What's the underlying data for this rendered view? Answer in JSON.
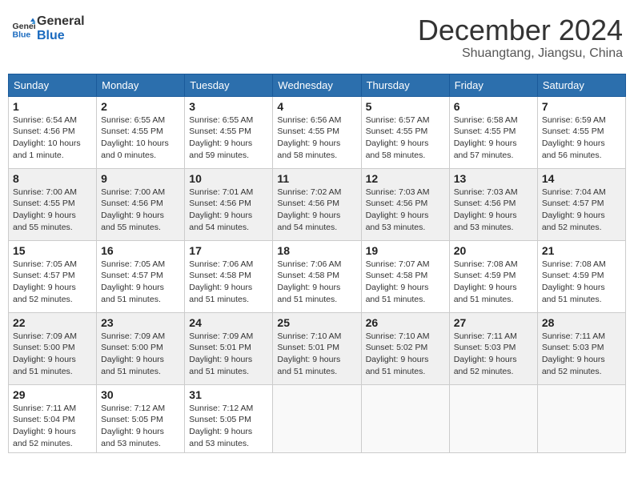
{
  "header": {
    "logo_general": "General",
    "logo_blue": "Blue",
    "month_title": "December 2024",
    "subtitle": "Shuangtang, Jiangsu, China"
  },
  "days_of_week": [
    "Sunday",
    "Monday",
    "Tuesday",
    "Wednesday",
    "Thursday",
    "Friday",
    "Saturday"
  ],
  "weeks": [
    [
      {
        "day": "1",
        "info": "Sunrise: 6:54 AM\nSunset: 4:56 PM\nDaylight: 10 hours\nand 1 minute."
      },
      {
        "day": "2",
        "info": "Sunrise: 6:55 AM\nSunset: 4:55 PM\nDaylight: 10 hours\nand 0 minutes."
      },
      {
        "day": "3",
        "info": "Sunrise: 6:55 AM\nSunset: 4:55 PM\nDaylight: 9 hours\nand 59 minutes."
      },
      {
        "day": "4",
        "info": "Sunrise: 6:56 AM\nSunset: 4:55 PM\nDaylight: 9 hours\nand 58 minutes."
      },
      {
        "day": "5",
        "info": "Sunrise: 6:57 AM\nSunset: 4:55 PM\nDaylight: 9 hours\nand 58 minutes."
      },
      {
        "day": "6",
        "info": "Sunrise: 6:58 AM\nSunset: 4:55 PM\nDaylight: 9 hours\nand 57 minutes."
      },
      {
        "day": "7",
        "info": "Sunrise: 6:59 AM\nSunset: 4:55 PM\nDaylight: 9 hours\nand 56 minutes."
      }
    ],
    [
      {
        "day": "8",
        "info": "Sunrise: 7:00 AM\nSunset: 4:55 PM\nDaylight: 9 hours\nand 55 minutes."
      },
      {
        "day": "9",
        "info": "Sunrise: 7:00 AM\nSunset: 4:56 PM\nDaylight: 9 hours\nand 55 minutes."
      },
      {
        "day": "10",
        "info": "Sunrise: 7:01 AM\nSunset: 4:56 PM\nDaylight: 9 hours\nand 54 minutes."
      },
      {
        "day": "11",
        "info": "Sunrise: 7:02 AM\nSunset: 4:56 PM\nDaylight: 9 hours\nand 54 minutes."
      },
      {
        "day": "12",
        "info": "Sunrise: 7:03 AM\nSunset: 4:56 PM\nDaylight: 9 hours\nand 53 minutes."
      },
      {
        "day": "13",
        "info": "Sunrise: 7:03 AM\nSunset: 4:56 PM\nDaylight: 9 hours\nand 53 minutes."
      },
      {
        "day": "14",
        "info": "Sunrise: 7:04 AM\nSunset: 4:57 PM\nDaylight: 9 hours\nand 52 minutes."
      }
    ],
    [
      {
        "day": "15",
        "info": "Sunrise: 7:05 AM\nSunset: 4:57 PM\nDaylight: 9 hours\nand 52 minutes."
      },
      {
        "day": "16",
        "info": "Sunrise: 7:05 AM\nSunset: 4:57 PM\nDaylight: 9 hours\nand 51 minutes."
      },
      {
        "day": "17",
        "info": "Sunrise: 7:06 AM\nSunset: 4:58 PM\nDaylight: 9 hours\nand 51 minutes."
      },
      {
        "day": "18",
        "info": "Sunrise: 7:06 AM\nSunset: 4:58 PM\nDaylight: 9 hours\nand 51 minutes."
      },
      {
        "day": "19",
        "info": "Sunrise: 7:07 AM\nSunset: 4:58 PM\nDaylight: 9 hours\nand 51 minutes."
      },
      {
        "day": "20",
        "info": "Sunrise: 7:08 AM\nSunset: 4:59 PM\nDaylight: 9 hours\nand 51 minutes."
      },
      {
        "day": "21",
        "info": "Sunrise: 7:08 AM\nSunset: 4:59 PM\nDaylight: 9 hours\nand 51 minutes."
      }
    ],
    [
      {
        "day": "22",
        "info": "Sunrise: 7:09 AM\nSunset: 5:00 PM\nDaylight: 9 hours\nand 51 minutes."
      },
      {
        "day": "23",
        "info": "Sunrise: 7:09 AM\nSunset: 5:00 PM\nDaylight: 9 hours\nand 51 minutes."
      },
      {
        "day": "24",
        "info": "Sunrise: 7:09 AM\nSunset: 5:01 PM\nDaylight: 9 hours\nand 51 minutes."
      },
      {
        "day": "25",
        "info": "Sunrise: 7:10 AM\nSunset: 5:01 PM\nDaylight: 9 hours\nand 51 minutes."
      },
      {
        "day": "26",
        "info": "Sunrise: 7:10 AM\nSunset: 5:02 PM\nDaylight: 9 hours\nand 51 minutes."
      },
      {
        "day": "27",
        "info": "Sunrise: 7:11 AM\nSunset: 5:03 PM\nDaylight: 9 hours\nand 52 minutes."
      },
      {
        "day": "28",
        "info": "Sunrise: 7:11 AM\nSunset: 5:03 PM\nDaylight: 9 hours\nand 52 minutes."
      }
    ],
    [
      {
        "day": "29",
        "info": "Sunrise: 7:11 AM\nSunset: 5:04 PM\nDaylight: 9 hours\nand 52 minutes."
      },
      {
        "day": "30",
        "info": "Sunrise: 7:12 AM\nSunset: 5:05 PM\nDaylight: 9 hours\nand 53 minutes."
      },
      {
        "day": "31",
        "info": "Sunrise: 7:12 AM\nSunset: 5:05 PM\nDaylight: 9 hours\nand 53 minutes."
      },
      null,
      null,
      null,
      null
    ]
  ]
}
